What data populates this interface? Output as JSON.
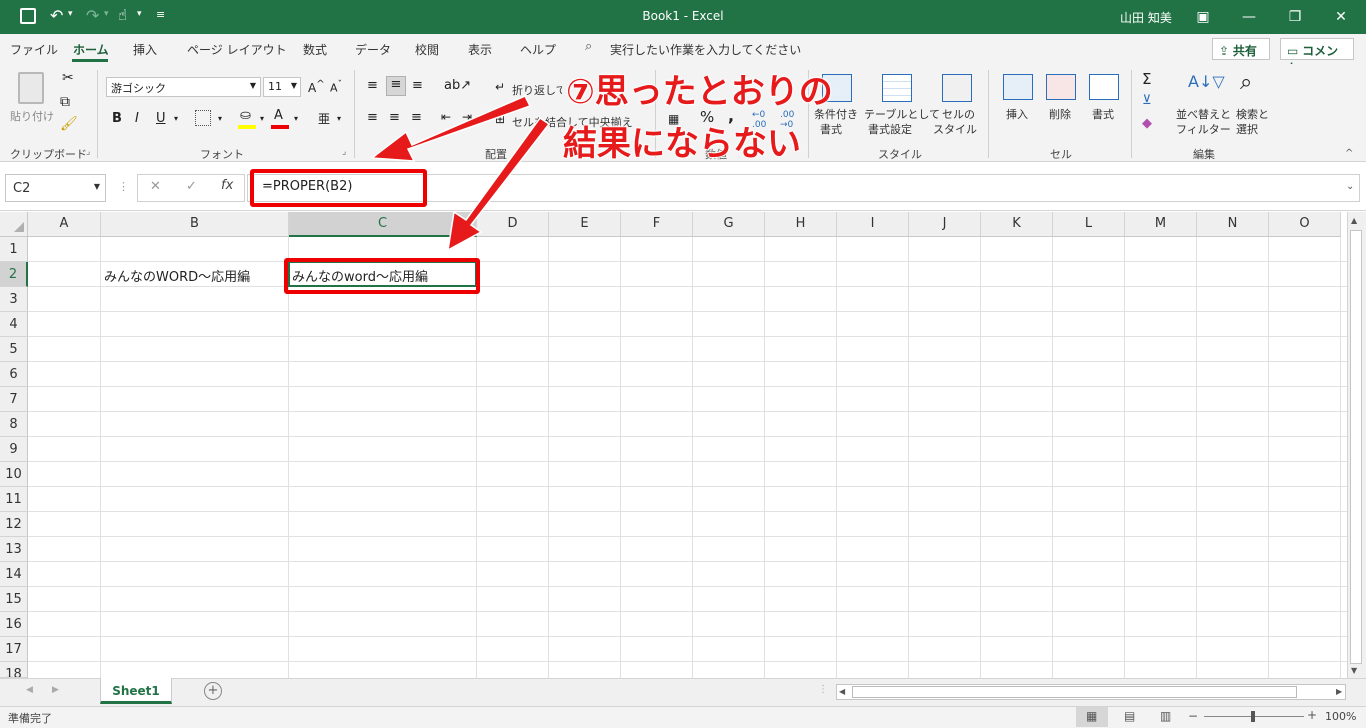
{
  "titlebar": {
    "title": "Book1  -  Excel",
    "user": "山田 知美"
  },
  "tabs": [
    "ファイル",
    "ホーム",
    "挿入",
    "ページ レイアウト",
    "数式",
    "データ",
    "校閲",
    "表示",
    "ヘルプ"
  ],
  "tellme": "実行したい作業を入力してください",
  "share": "共有",
  "comment": "コメント",
  "ribbon": {
    "paste": "貼り付け",
    "clipboard": "クリップボード",
    "font_name": "游ゴシック",
    "font_size": "11",
    "font_group": "フォント",
    "wrap": "折り返して全体を表示する",
    "merge": "セルを結合して中央揃え",
    "align_group": "配置",
    "number_group": "数値",
    "cond1": "条件付き",
    "cond2": "書式",
    "table1": "テーブルとして",
    "table2": "書式設定",
    "cellstyle1": "セルの",
    "cellstyle2": "スタイル",
    "style_group": "スタイル",
    "insert": "挿入",
    "delete": "削除",
    "format": "書式",
    "cells_group": "セル",
    "sort1": "並べ替えと",
    "sort2": "フィルター",
    "find1": "検索と",
    "find2": "選択",
    "edit_group": "編集"
  },
  "namebox": "C2",
  "formula": "=PROPER(B2)",
  "columns": [
    "A",
    "B",
    "C",
    "D",
    "E",
    "F",
    "G",
    "H",
    "I",
    "J",
    "K",
    "L",
    "M",
    "N",
    "O"
  ],
  "rows": [
    "1",
    "2",
    "3",
    "4",
    "5",
    "6",
    "7",
    "8",
    "9",
    "10",
    "11",
    "12",
    "13",
    "14",
    "15",
    "16",
    "17",
    "18"
  ],
  "cells": {
    "B2": "みんなのWORD～応用編",
    "C2": "みんなのword～応用編"
  },
  "sheet": "Sheet1",
  "status": "準備完了",
  "zoom": "100%",
  "annotation": {
    "line1": "⑦思ったとおりの",
    "line2": "結果にならない"
  }
}
